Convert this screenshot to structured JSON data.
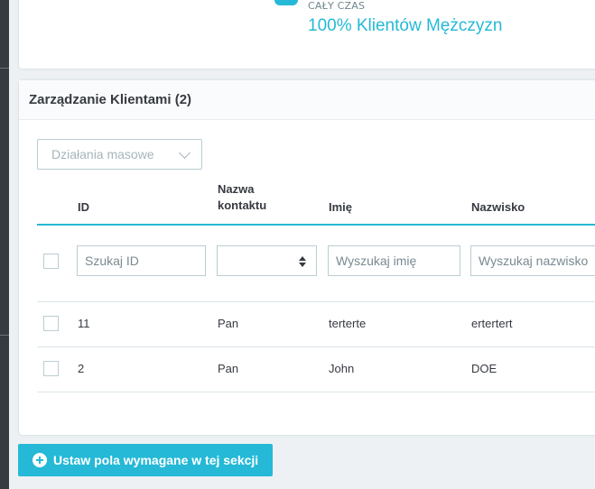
{
  "stats": {
    "label": "CAŁY CZAS",
    "value": "100% Klientów Mężczyzn"
  },
  "panel": {
    "title": "Zarządzanie Klientami (2)"
  },
  "bulk_actions": {
    "label": "Działania masowe"
  },
  "table": {
    "headers": {
      "id": "ID",
      "contact_line1": "Nazwa",
      "contact_line2": "kontaktu",
      "first_name": "Imię",
      "last_name": "Nazwisko"
    },
    "filters": {
      "id_placeholder": "Szukaj ID",
      "first_name_placeholder": "Wyszukaj imię",
      "last_name_placeholder": "Wyszukaj nazwisko"
    },
    "rows": [
      {
        "id": "11",
        "contact": "Pan",
        "first_name": "terterte",
        "last_name": "ertertert"
      },
      {
        "id": "2",
        "contact": "Pan",
        "first_name": "John",
        "last_name": "DOE"
      }
    ]
  },
  "action_button": {
    "label": "Ustaw pola wymagane w tej sekcji"
  },
  "colors": {
    "accent": "#25b9d7",
    "text": "#363a41",
    "border": "#bbcdd2"
  }
}
